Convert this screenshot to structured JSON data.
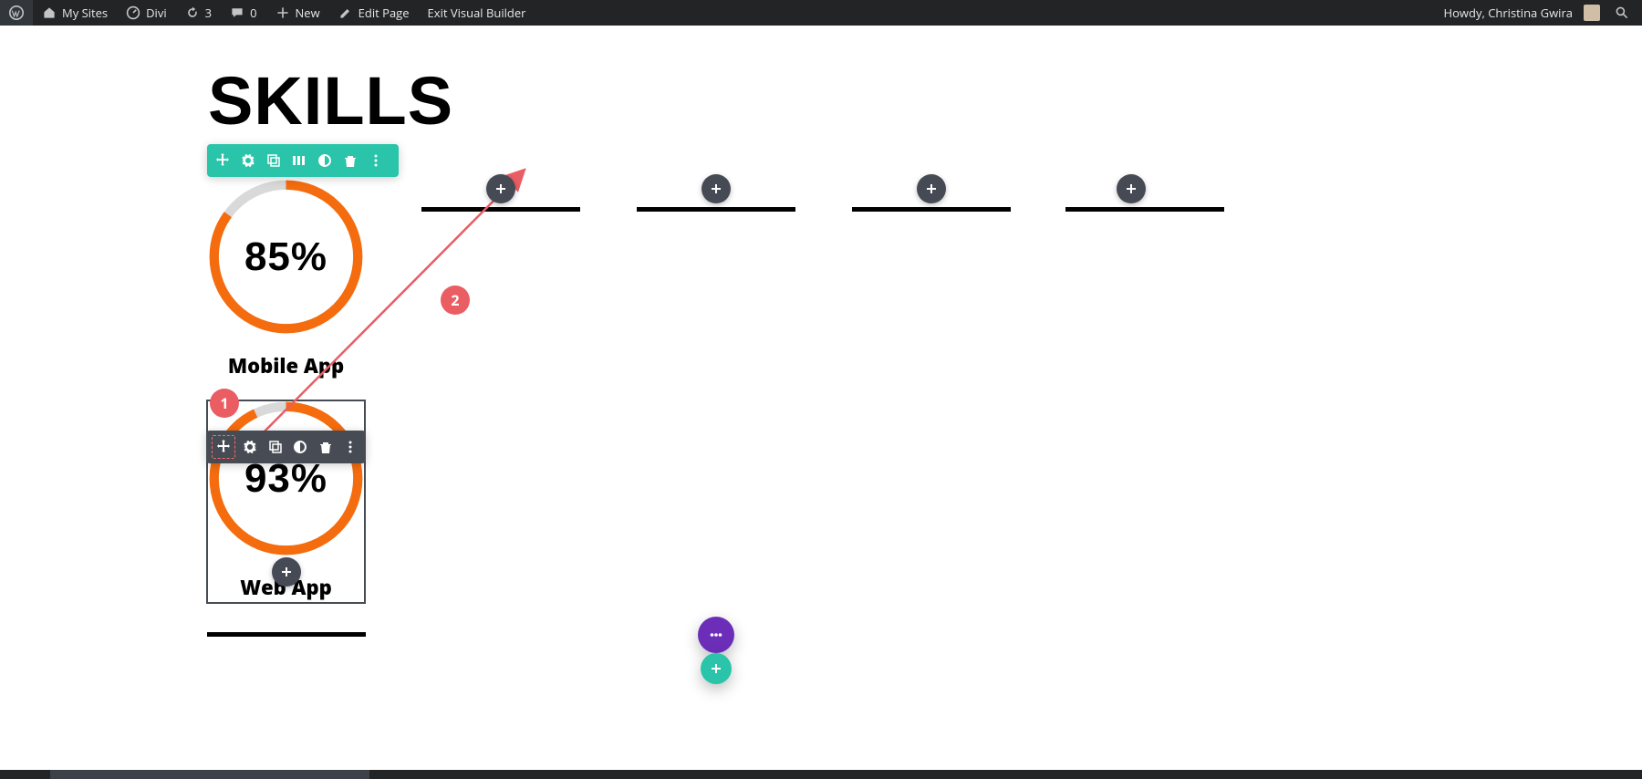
{
  "admin": {
    "mysites": "My Sites",
    "divi": "Divi",
    "updates": "3",
    "comments": "0",
    "new": "New",
    "edit": "Edit Page",
    "exit": "Exit Visual Builder",
    "howdy": "Howdy, Christina Gwira"
  },
  "page": {
    "title": "SKILLS"
  },
  "counters": [
    {
      "value": 85,
      "display": "85%",
      "label": "Mobile App"
    },
    {
      "value": 93,
      "display": "93%",
      "label": "Web App"
    }
  ],
  "markers": {
    "one": "1",
    "two": "2"
  },
  "colors": {
    "accent_orange": "#f46c0e",
    "row_teal": "#29c4a9",
    "module_gray": "#474c54",
    "add_dark": "#454a54",
    "fab_purple": "#6c2eb9",
    "marker_red": "#e95d63"
  }
}
